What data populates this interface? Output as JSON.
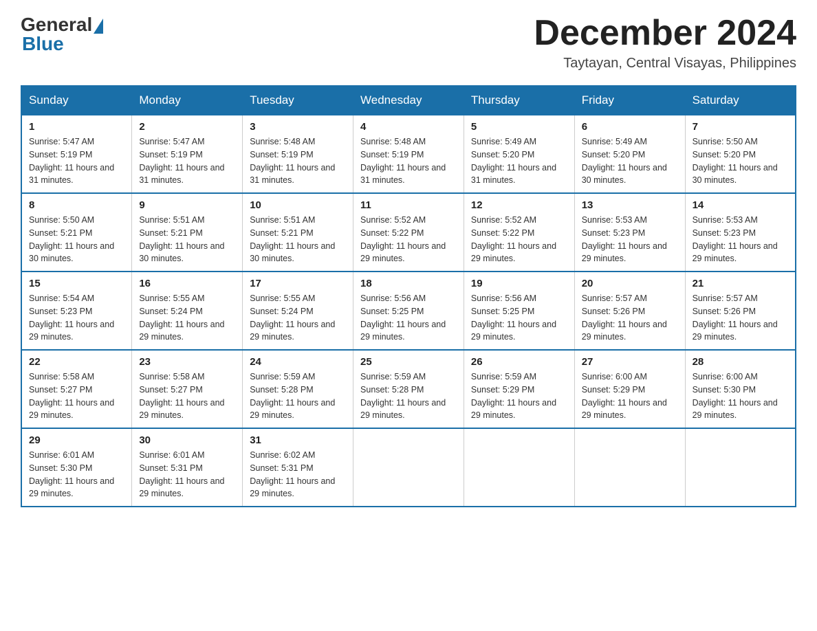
{
  "logo": {
    "general": "General",
    "blue": "Blue"
  },
  "title": "December 2024",
  "subtitle": "Taytayan, Central Visayas, Philippines",
  "days_of_week": [
    "Sunday",
    "Monday",
    "Tuesday",
    "Wednesday",
    "Thursday",
    "Friday",
    "Saturday"
  ],
  "weeks": [
    [
      {
        "day": "1",
        "sunrise": "5:47 AM",
        "sunset": "5:19 PM",
        "daylight": "11 hours and 31 minutes."
      },
      {
        "day": "2",
        "sunrise": "5:47 AM",
        "sunset": "5:19 PM",
        "daylight": "11 hours and 31 minutes."
      },
      {
        "day": "3",
        "sunrise": "5:48 AM",
        "sunset": "5:19 PM",
        "daylight": "11 hours and 31 minutes."
      },
      {
        "day": "4",
        "sunrise": "5:48 AM",
        "sunset": "5:19 PM",
        "daylight": "11 hours and 31 minutes."
      },
      {
        "day": "5",
        "sunrise": "5:49 AM",
        "sunset": "5:20 PM",
        "daylight": "11 hours and 31 minutes."
      },
      {
        "day": "6",
        "sunrise": "5:49 AM",
        "sunset": "5:20 PM",
        "daylight": "11 hours and 30 minutes."
      },
      {
        "day": "7",
        "sunrise": "5:50 AM",
        "sunset": "5:20 PM",
        "daylight": "11 hours and 30 minutes."
      }
    ],
    [
      {
        "day": "8",
        "sunrise": "5:50 AM",
        "sunset": "5:21 PM",
        "daylight": "11 hours and 30 minutes."
      },
      {
        "day": "9",
        "sunrise": "5:51 AM",
        "sunset": "5:21 PM",
        "daylight": "11 hours and 30 minutes."
      },
      {
        "day": "10",
        "sunrise": "5:51 AM",
        "sunset": "5:21 PM",
        "daylight": "11 hours and 30 minutes."
      },
      {
        "day": "11",
        "sunrise": "5:52 AM",
        "sunset": "5:22 PM",
        "daylight": "11 hours and 29 minutes."
      },
      {
        "day": "12",
        "sunrise": "5:52 AM",
        "sunset": "5:22 PM",
        "daylight": "11 hours and 29 minutes."
      },
      {
        "day": "13",
        "sunrise": "5:53 AM",
        "sunset": "5:23 PM",
        "daylight": "11 hours and 29 minutes."
      },
      {
        "day": "14",
        "sunrise": "5:53 AM",
        "sunset": "5:23 PM",
        "daylight": "11 hours and 29 minutes."
      }
    ],
    [
      {
        "day": "15",
        "sunrise": "5:54 AM",
        "sunset": "5:23 PM",
        "daylight": "11 hours and 29 minutes."
      },
      {
        "day": "16",
        "sunrise": "5:55 AM",
        "sunset": "5:24 PM",
        "daylight": "11 hours and 29 minutes."
      },
      {
        "day": "17",
        "sunrise": "5:55 AM",
        "sunset": "5:24 PM",
        "daylight": "11 hours and 29 minutes."
      },
      {
        "day": "18",
        "sunrise": "5:56 AM",
        "sunset": "5:25 PM",
        "daylight": "11 hours and 29 minutes."
      },
      {
        "day": "19",
        "sunrise": "5:56 AM",
        "sunset": "5:25 PM",
        "daylight": "11 hours and 29 minutes."
      },
      {
        "day": "20",
        "sunrise": "5:57 AM",
        "sunset": "5:26 PM",
        "daylight": "11 hours and 29 minutes."
      },
      {
        "day": "21",
        "sunrise": "5:57 AM",
        "sunset": "5:26 PM",
        "daylight": "11 hours and 29 minutes."
      }
    ],
    [
      {
        "day": "22",
        "sunrise": "5:58 AM",
        "sunset": "5:27 PM",
        "daylight": "11 hours and 29 minutes."
      },
      {
        "day": "23",
        "sunrise": "5:58 AM",
        "sunset": "5:27 PM",
        "daylight": "11 hours and 29 minutes."
      },
      {
        "day": "24",
        "sunrise": "5:59 AM",
        "sunset": "5:28 PM",
        "daylight": "11 hours and 29 minutes."
      },
      {
        "day": "25",
        "sunrise": "5:59 AM",
        "sunset": "5:28 PM",
        "daylight": "11 hours and 29 minutes."
      },
      {
        "day": "26",
        "sunrise": "5:59 AM",
        "sunset": "5:29 PM",
        "daylight": "11 hours and 29 minutes."
      },
      {
        "day": "27",
        "sunrise": "6:00 AM",
        "sunset": "5:29 PM",
        "daylight": "11 hours and 29 minutes."
      },
      {
        "day": "28",
        "sunrise": "6:00 AM",
        "sunset": "5:30 PM",
        "daylight": "11 hours and 29 minutes."
      }
    ],
    [
      {
        "day": "29",
        "sunrise": "6:01 AM",
        "sunset": "5:30 PM",
        "daylight": "11 hours and 29 minutes."
      },
      {
        "day": "30",
        "sunrise": "6:01 AM",
        "sunset": "5:31 PM",
        "daylight": "11 hours and 29 minutes."
      },
      {
        "day": "31",
        "sunrise": "6:02 AM",
        "sunset": "5:31 PM",
        "daylight": "11 hours and 29 minutes."
      },
      null,
      null,
      null,
      null
    ]
  ],
  "labels": {
    "sunrise": "Sunrise: ",
    "sunset": "Sunset: ",
    "daylight": "Daylight: "
  }
}
